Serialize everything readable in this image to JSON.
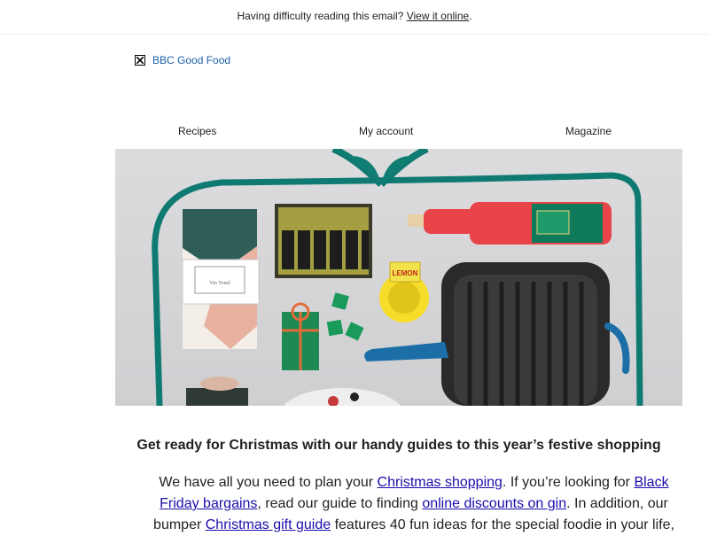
{
  "topbar": {
    "prefix": "Having difficulty reading this email?",
    "link": "View it online",
    "suffix": "."
  },
  "logo": {
    "alt_text": "BBC Good Food"
  },
  "nav": {
    "items": [
      {
        "label": "Recipes"
      },
      {
        "label": "My account"
      },
      {
        "label": "Magazine"
      }
    ]
  },
  "hero": {
    "tag_text": "Vin Tonel",
    "lemon_label": "LEMON"
  },
  "content": {
    "headline": "Get ready for Christmas with our handy guides to this year’s festive shopping",
    "p1_a": "We have all you need to plan your ",
    "link_christmas_shopping": "Christmas shopping",
    "p1_b": ". If you’re looking for ",
    "link_black_friday": "Black Friday bargains",
    "p1_c": ", read our guide to finding ",
    "link_gin": "online discounts on gin",
    "p1_d": ". In addition, our bumper ",
    "link_gift_guide": "Christmas gift guide",
    "p1_e": " features 40 fun ideas for the special foodie in your life,"
  },
  "colors": {
    "link": "#1a0dab",
    "logo_link": "#1a5eaa",
    "ribbon": "#0f7a72",
    "pan": "#2a2a2a",
    "pan_handle": "#1b6fa6",
    "bottle": "#e8444a"
  }
}
